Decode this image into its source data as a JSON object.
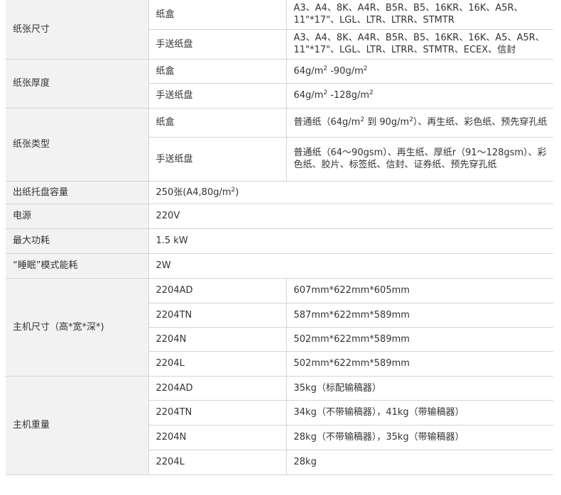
{
  "rows": {
    "paper_size": {
      "label": "纸张尺寸",
      "cassette": {
        "label": "纸盒",
        "value": "A3、A4、8K、A4R、B5R、B5、16KR、16K、A5R、11\"*17\"、LGL、LTR、LTRR、STMTR"
      },
      "bypass": {
        "label": "手送纸盘",
        "value": "A3、A4、8K、A4R、B5R、B5、16KR、16K、A5、A5R、11\"*17\"、LGL、LTR、LTRR、STMTR、ECEX、信封"
      }
    },
    "paper_weight": {
      "label": "纸张厚度",
      "cassette": {
        "label": "纸盒",
        "a": "64g/m",
        "sup1": "2",
        "b": " -90g/m",
        "sup2": "2"
      },
      "bypass": {
        "label": "手送纸盘",
        "a": "64g/m",
        "sup1": "2",
        "b": " -128g/m",
        "sup2": "2"
      }
    },
    "paper_type": {
      "label": "纸张类型",
      "cassette": {
        "label": "纸盒",
        "a": "普通纸（64g/m",
        "sup1": "2",
        "b": " 到 90g/m",
        "sup2": "2",
        "c": "）、再生纸、彩色纸、预先穿孔纸"
      },
      "bypass": {
        "label": "手送纸盘",
        "value": "普通纸（64～90gsm）、再生纸、厚纸r（91～128gsm）、彩色纸、胶片、标签纸、信封、证券纸、预先穿孔纸"
      }
    },
    "output_capacity": {
      "label": "出纸托盘容量",
      "a": "250张(A4,80g/m",
      "sup": "2",
      "b": ")"
    },
    "power": {
      "label": "电源",
      "value": "220V"
    },
    "max_power": {
      "label": "最大功耗",
      "value": "1.5 kW"
    },
    "sleep_power": {
      "label": "“睡眠”模式能耗",
      "value": "2W"
    },
    "dimensions": {
      "label": "主机尺寸（高*宽*深*)",
      "items": [
        {
          "model": "2204AD",
          "value": "607mm*622mm*605mm"
        },
        {
          "model": "2204TN",
          "value": "587mm*622mm*589mm"
        },
        {
          "model": "2204N",
          "value": "502mm*622mm*589mm"
        },
        {
          "model": "2204L",
          "value": "502mm*622mm*589mm"
        }
      ]
    },
    "weight": {
      "label": "主机重量",
      "items": [
        {
          "model": "2204AD",
          "value": "35kg（标配输稿器）"
        },
        {
          "model": "2204TN",
          "value": "34kg（不带输稿器），41kg（带输稿器）"
        },
        {
          "model": "2204N",
          "value": "28kg（不带输稿器），35kg（带输稿器）"
        },
        {
          "model": "2204L",
          "value": "28kg"
        }
      ]
    }
  }
}
